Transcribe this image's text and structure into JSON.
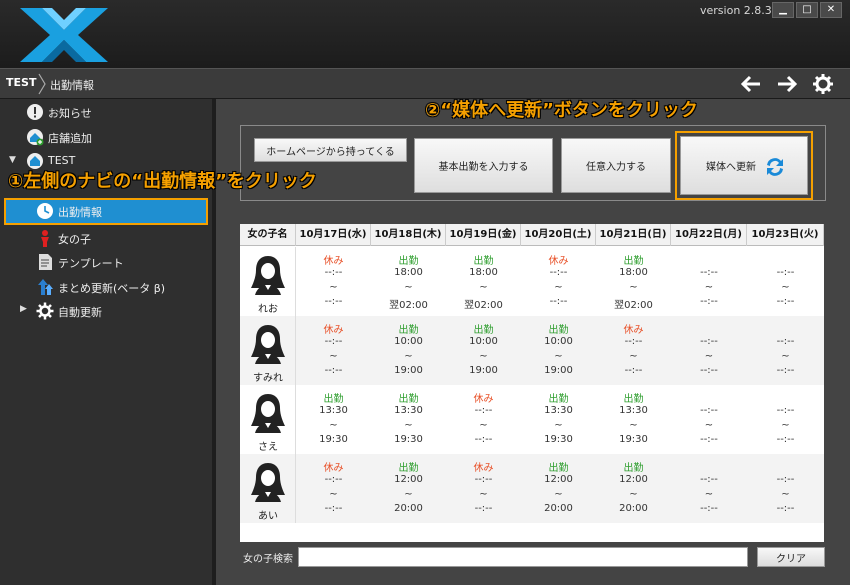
{
  "window": {
    "version": "version 2.8.3",
    "min_label": "▁",
    "max_label": "□",
    "close_label": "✕"
  },
  "nav": {
    "root": "TEST",
    "page": "出勤情報"
  },
  "sidebar": {
    "items": [
      {
        "label": "お知らせ",
        "icon": "alert-icon"
      },
      {
        "label": "店舗追加",
        "icon": "add-shop-icon"
      },
      {
        "label": "TEST",
        "icon": "home-icon"
      },
      {
        "label": "出勤情報",
        "icon": "clock-icon"
      },
      {
        "label": "女の子",
        "icon": "girl-icon"
      },
      {
        "label": "テンプレート",
        "icon": "template-icon"
      },
      {
        "label": "まとめ更新(ベータ β)",
        "icon": "batch-update-icon"
      },
      {
        "label": "自動更新",
        "icon": "gear-icon"
      }
    ]
  },
  "callouts": {
    "step1": "①左側のナビの“出勤情報”をクリック",
    "step2": "②“媒体へ更新”ボタンをクリック"
  },
  "buttons": {
    "homepage": "ホームページから持ってくる",
    "basic": "基本出勤を入力する",
    "any": "任意入力する",
    "update": "媒体へ更新"
  },
  "grid": {
    "name_header": "女の子名",
    "dates": [
      "10月17日(水)",
      "10月18日(木)",
      "10月19日(金)",
      "10月20日(土)",
      "10月21日(日)",
      "10月22日(月)",
      "10月23日(火)"
    ],
    "rows": [
      {
        "name": "れお",
        "days": [
          {
            "status": "休み",
            "kind": "off",
            "start": "--:--",
            "sep": "~",
            "end": "--:--"
          },
          {
            "status": "出勤",
            "kind": "on",
            "start": "18:00",
            "sep": "~",
            "end": "翌02:00"
          },
          {
            "status": "出勤",
            "kind": "on",
            "start": "18:00",
            "sep": "~",
            "end": "翌02:00"
          },
          {
            "status": "休み",
            "kind": "off",
            "start": "--:--",
            "sep": "~",
            "end": "--:--"
          },
          {
            "status": "出勤",
            "kind": "on",
            "start": "18:00",
            "sep": "~",
            "end": "翌02:00"
          },
          {
            "status": "",
            "kind": "none",
            "start": "--:--",
            "sep": "~",
            "end": "--:--"
          },
          {
            "status": "",
            "kind": "none",
            "start": "--:--",
            "sep": "~",
            "end": "--:--"
          }
        ]
      },
      {
        "name": "すみれ",
        "days": [
          {
            "status": "休み",
            "kind": "off",
            "start": "--:--",
            "sep": "~",
            "end": "--:--"
          },
          {
            "status": "出勤",
            "kind": "on",
            "start": "10:00",
            "sep": "~",
            "end": "19:00"
          },
          {
            "status": "出勤",
            "kind": "on",
            "start": "10:00",
            "sep": "~",
            "end": "19:00"
          },
          {
            "status": "出勤",
            "kind": "on",
            "start": "10:00",
            "sep": "~",
            "end": "19:00"
          },
          {
            "status": "休み",
            "kind": "off",
            "start": "--:--",
            "sep": "~",
            "end": "--:--"
          },
          {
            "status": "",
            "kind": "none",
            "start": "--:--",
            "sep": "~",
            "end": "--:--"
          },
          {
            "status": "",
            "kind": "none",
            "start": "--:--",
            "sep": "~",
            "end": "--:--"
          }
        ]
      },
      {
        "name": "さえ",
        "days": [
          {
            "status": "出勤",
            "kind": "on",
            "start": "13:30",
            "sep": "~",
            "end": "19:30"
          },
          {
            "status": "出勤",
            "kind": "on",
            "start": "13:30",
            "sep": "~",
            "end": "19:30"
          },
          {
            "status": "休み",
            "kind": "off",
            "start": "--:--",
            "sep": "~",
            "end": "--:--"
          },
          {
            "status": "出勤",
            "kind": "on",
            "start": "13:30",
            "sep": "~",
            "end": "19:30"
          },
          {
            "status": "出勤",
            "kind": "on",
            "start": "13:30",
            "sep": "~",
            "end": "19:30"
          },
          {
            "status": "",
            "kind": "none",
            "start": "--:--",
            "sep": "~",
            "end": "--:--"
          },
          {
            "status": "",
            "kind": "none",
            "start": "--:--",
            "sep": "~",
            "end": "--:--"
          }
        ]
      },
      {
        "name": "あい",
        "days": [
          {
            "status": "休み",
            "kind": "off",
            "start": "--:--",
            "sep": "~",
            "end": "--:--"
          },
          {
            "status": "出勤",
            "kind": "on",
            "start": "12:00",
            "sep": "~",
            "end": "20:00"
          },
          {
            "status": "休み",
            "kind": "off",
            "start": "--:--",
            "sep": "~",
            "end": "--:--"
          },
          {
            "status": "出勤",
            "kind": "on",
            "start": "12:00",
            "sep": "~",
            "end": "20:00"
          },
          {
            "status": "出勤",
            "kind": "on",
            "start": "12:00",
            "sep": "~",
            "end": "20:00"
          },
          {
            "status": "",
            "kind": "none",
            "start": "--:--",
            "sep": "~",
            "end": "--:--"
          },
          {
            "status": "",
            "kind": "none",
            "start": "--:--",
            "sep": "~",
            "end": "--:--"
          }
        ]
      }
    ]
  },
  "search": {
    "label": "女の子検索",
    "value": "",
    "clear_label": "クリア"
  },
  "colors": {
    "accent": "#1f8fd1",
    "callout": "#f5a000",
    "working": "#2e9e2e",
    "off": "#e8522a"
  }
}
